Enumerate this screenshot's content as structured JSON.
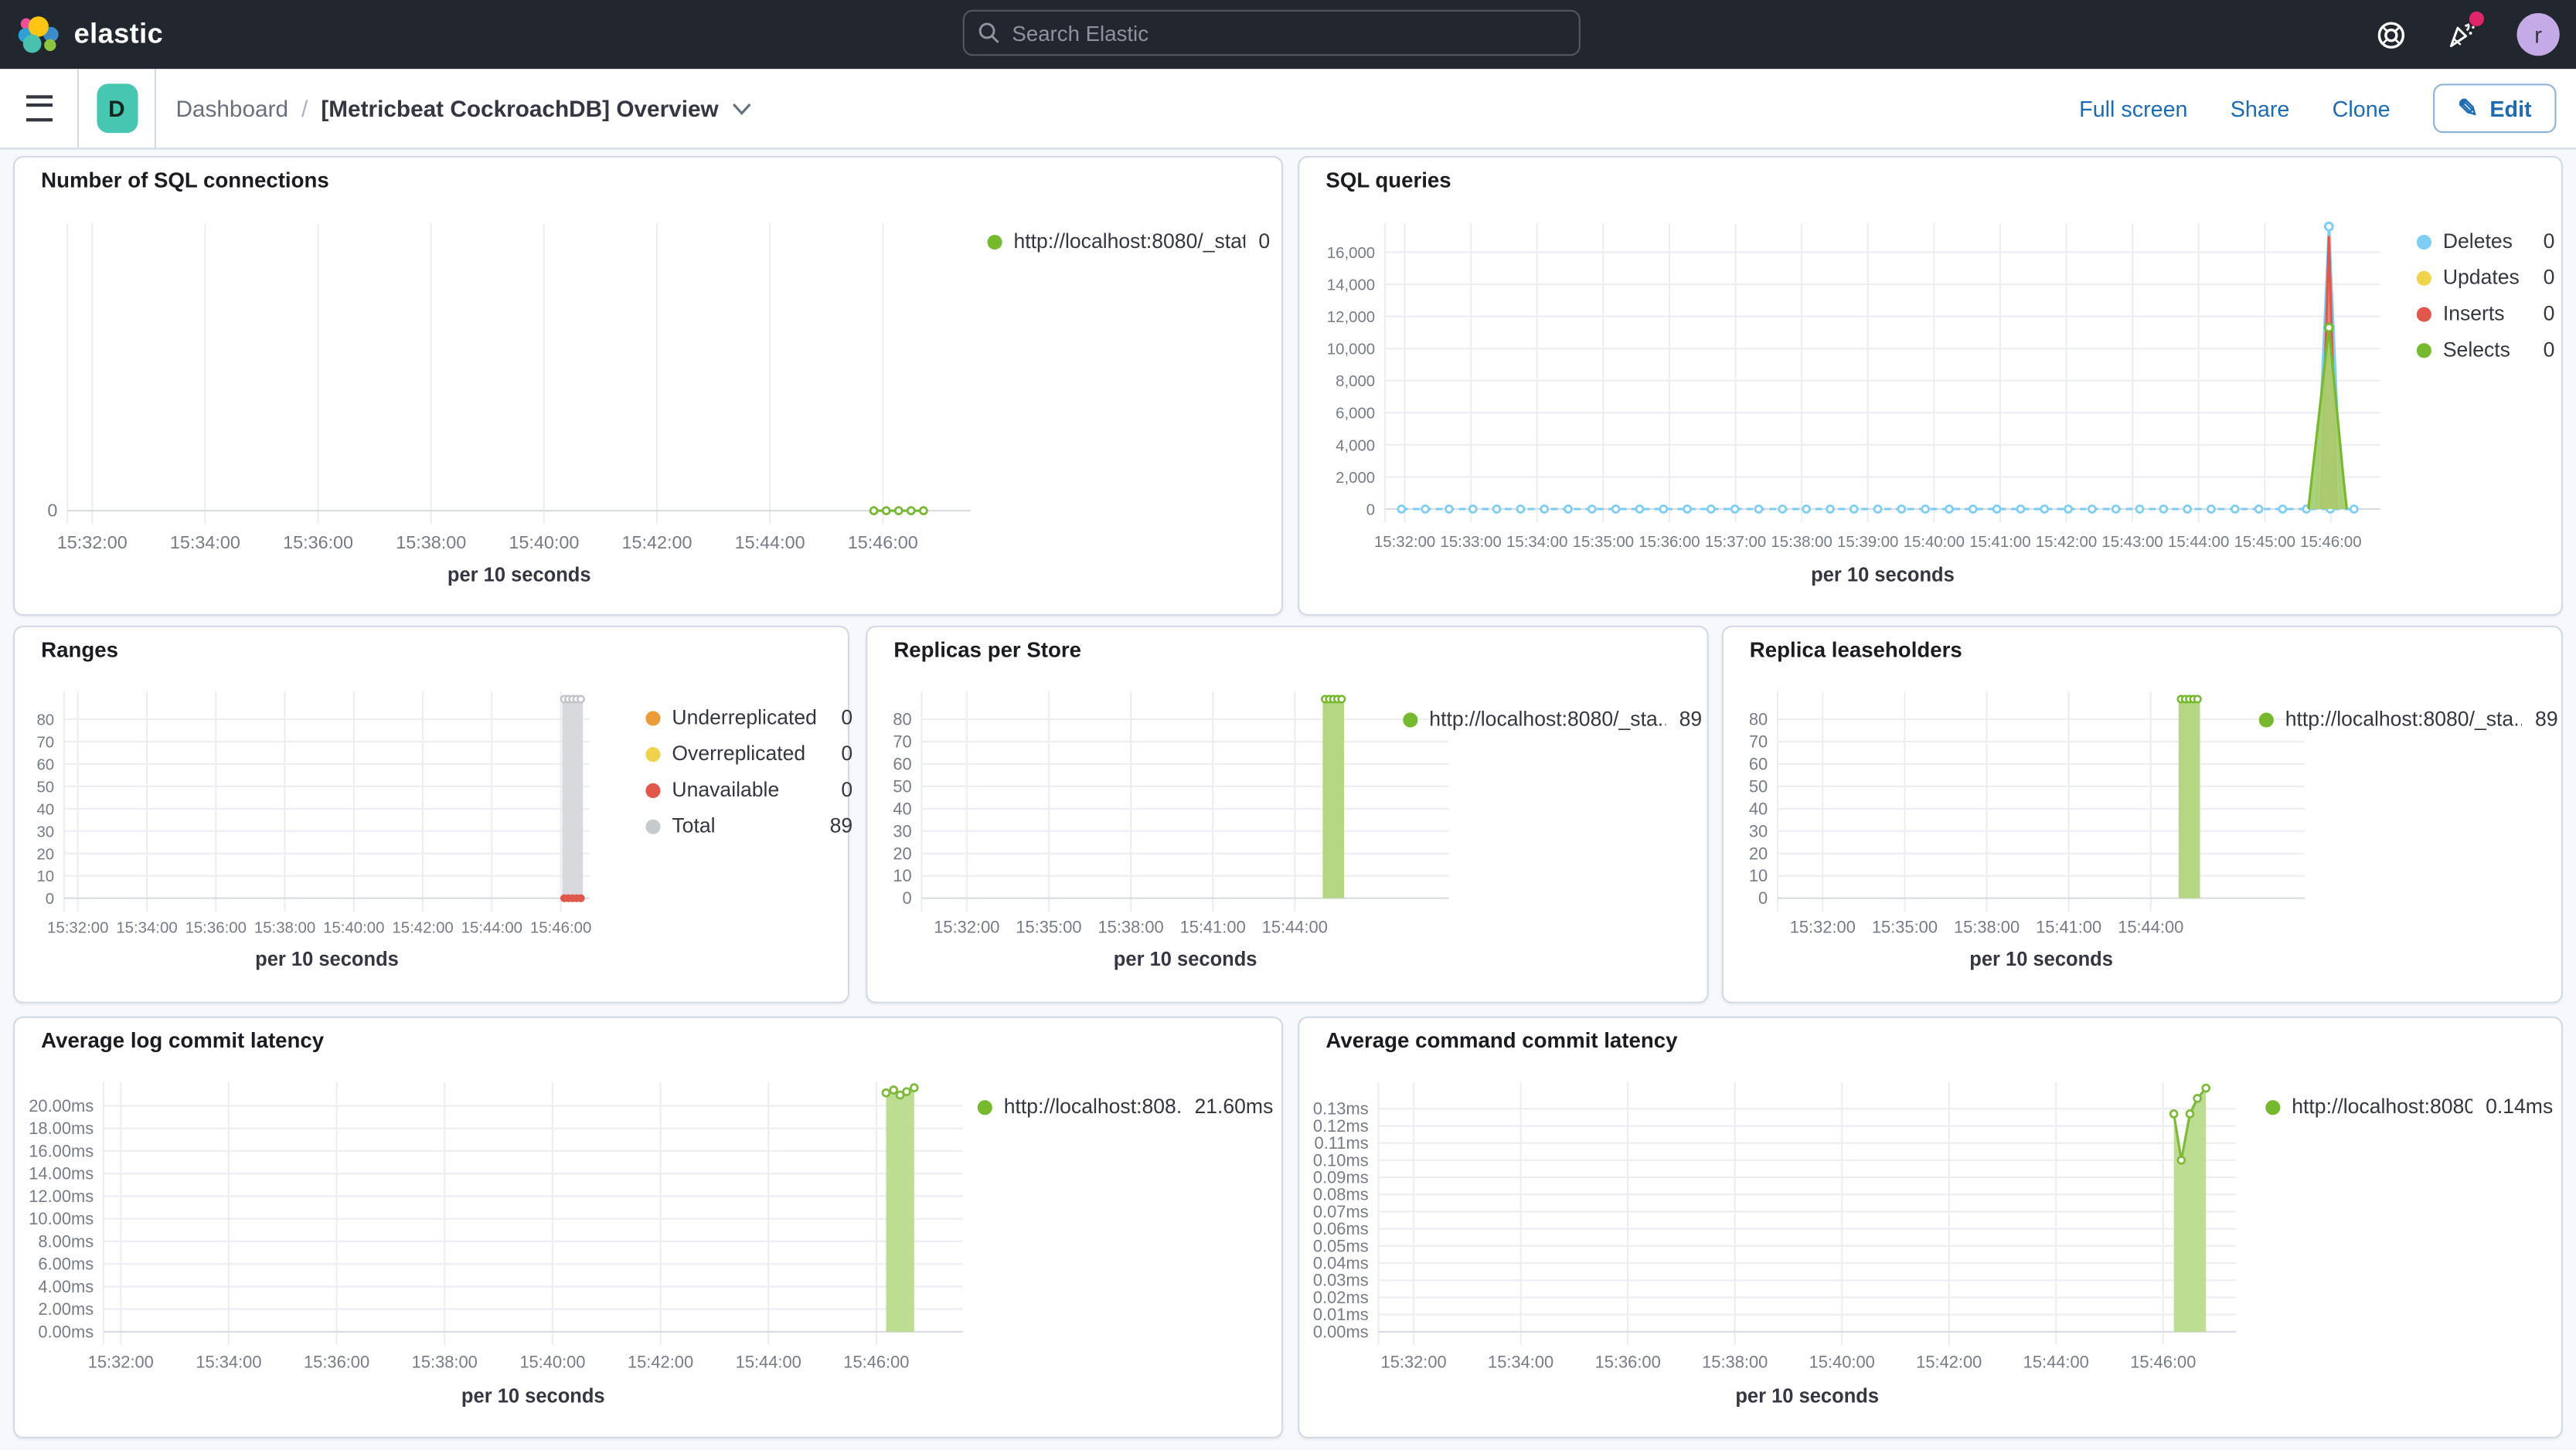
{
  "header": {
    "brand": "elastic",
    "search_placeholder": "Search Elastic",
    "avatar_initial": "r",
    "colors": {
      "header_bg": "#22262e",
      "notification_dot": "#e0256b",
      "avatar_bg": "#c5aae8",
      "space_badge": "#47c6b1",
      "link_blue": "#1d6cb2"
    }
  },
  "breadcrumbs": {
    "space_initial": "D",
    "root": "Dashboard",
    "separator": "/",
    "current": "[Metricbeat CockroachDB] Overview"
  },
  "toolbar": {
    "full_screen": "Full screen",
    "share": "Share",
    "clone": "Clone",
    "edit": "Edit"
  },
  "panels": [
    {
      "title": "Number of SQL connections",
      "legend": [
        {
          "label": "http://localhost:8080/_stat...",
          "value": "0",
          "color": "#76b82e"
        }
      ],
      "chart_data": {
        "type": "line",
        "xlabel": "per 10 seconds",
        "x_ticks": [
          "15:32:00",
          "15:34:00",
          "15:36:00",
          "15:38:00",
          "15:40:00",
          "15:42:00",
          "15:44:00",
          "15:46:00"
        ],
        "x_domain": [
          -0.22,
          7.78
        ],
        "ylim": [
          0,
          1.4
        ],
        "y_ticks": [
          {
            "v": 0,
            "label": "0"
          }
        ],
        "series": [
          {
            "name": "http://localhost:8080/_stat...",
            "type": "line",
            "color": "#76b82e",
            "marker": true,
            "points": [
              [
                6.92,
                0
              ],
              [
                7.03,
                0
              ],
              [
                7.14,
                0
              ],
              [
                7.25,
                0
              ],
              [
                7.36,
                0
              ]
            ]
          }
        ]
      }
    },
    {
      "title": "SQL queries",
      "legend": [
        {
          "label": "Deletes",
          "value": "0",
          "color": "#7ecdf2"
        },
        {
          "label": "Updates",
          "value": "0",
          "color": "#efd44c"
        },
        {
          "label": "Inserts",
          "value": "0",
          "color": "#e2574c"
        },
        {
          "label": "Selects",
          "value": "0",
          "color": "#76b82e"
        }
      ],
      "chart_data": {
        "type": "line",
        "xlabel": "per 10 seconds",
        "x_ticks": [
          "15:32:00",
          "15:33:00",
          "15:34:00",
          "15:35:00",
          "15:36:00",
          "15:37:00",
          "15:38:00",
          "15:39:00",
          "15:40:00",
          "15:41:00",
          "15:42:00",
          "15:43:00",
          "15:44:00",
          "15:45:00",
          "15:46:00"
        ],
        "x_domain": [
          -0.3,
          14.75
        ],
        "ylim": [
          0,
          17800
        ],
        "y_ticks": [
          {
            "v": 16000,
            "label": "16,000"
          },
          {
            "v": 14000,
            "label": "14,000"
          },
          {
            "v": 12000,
            "label": "12,000"
          },
          {
            "v": 10000,
            "label": "10,000"
          },
          {
            "v": 8000,
            "label": "8,000"
          },
          {
            "v": 6000,
            "label": "6,000"
          },
          {
            "v": 4000,
            "label": "4,000"
          },
          {
            "v": 2000,
            "label": "2,000"
          },
          {
            "v": 0,
            "label": "0"
          }
        ],
        "series": [
          {
            "name": "Deletes",
            "type": "line",
            "color": "#7ecdf2",
            "dash": true,
            "marker": true,
            "y_const": 0,
            "x_range": [
              -0.05,
              14.6
            ],
            "marker_step": 0.36
          },
          {
            "name": "Deletes",
            "type": "line",
            "color": "#7ecdf2",
            "marker": "peak",
            "points": [
              [
                13.78,
                0
              ],
              [
                13.97,
                17600
              ],
              [
                14.16,
                0
              ]
            ]
          },
          {
            "name": "Inserts",
            "type": "area",
            "color": "#e2574c",
            "fill": "#e2574c",
            "fill_opacity": 0.72,
            "points": [
              [
                13.85,
                0
              ],
              [
                13.97,
                17000
              ],
              [
                14.09,
                0
              ]
            ]
          },
          {
            "name": "Selects",
            "type": "area",
            "color": "#76b82e",
            "fill": "#a9cf70",
            "fill_opacity": 0.95,
            "marker": "peak",
            "points": [
              [
                13.66,
                0
              ],
              [
                13.7,
                1500
              ],
              [
                13.97,
                11300
              ],
              [
                14.2,
                1500
              ],
              [
                14.24,
                0
              ]
            ]
          }
        ]
      }
    },
    {
      "title": "Ranges",
      "legend": [
        {
          "label": "Underreplicated",
          "value": "0",
          "color": "#ec9b3a"
        },
        {
          "label": "Overreplicated",
          "value": "0",
          "color": "#f0d34c"
        },
        {
          "label": "Unavailable",
          "value": "0",
          "color": "#e2574c"
        },
        {
          "label": "Total",
          "value": "89",
          "color": "#c6c9ce"
        }
      ],
      "chart_data": {
        "type": "bar",
        "xlabel": "per 10 seconds",
        "x_ticks": [
          "15:32:00",
          "15:34:00",
          "15:36:00",
          "15:38:00",
          "15:40:00",
          "15:42:00",
          "15:44:00",
          "15:46:00"
        ],
        "x_domain": [
          -0.2,
          7.42
        ],
        "ylim": [
          0,
          92.5
        ],
        "y_ticks": [
          {
            "v": 80,
            "label": "80"
          },
          {
            "v": 70,
            "label": "70"
          },
          {
            "v": 60,
            "label": "60"
          },
          {
            "v": 50,
            "label": "50"
          },
          {
            "v": 40,
            "label": "40"
          },
          {
            "v": 30,
            "label": "30"
          },
          {
            "v": 20,
            "label": "20"
          },
          {
            "v": 10,
            "label": "10"
          },
          {
            "v": 0,
            "label": "0"
          }
        ],
        "series": [
          {
            "name": "Total",
            "type": "bar",
            "color": "#d7d9dd",
            "x": 7.17,
            "bar_width": 0.3,
            "y": 89
          },
          {
            "name": "Total",
            "type": "dots",
            "color": "#c2c5cb",
            "hollow": true,
            "r": 2,
            "points": [
              [
                7.05,
                89
              ],
              [
                7.11,
                89
              ],
              [
                7.17,
                89
              ],
              [
                7.23,
                89
              ],
              [
                7.29,
                89
              ]
            ]
          },
          {
            "name": "Unavailable",
            "type": "dots",
            "color": "#e2574c",
            "r": 2.4,
            "points": [
              [
                7.05,
                0
              ],
              [
                7.11,
                0
              ],
              [
                7.17,
                0
              ],
              [
                7.23,
                0
              ],
              [
                7.29,
                0
              ]
            ]
          }
        ]
      }
    },
    {
      "title": "Replicas per Store",
      "legend": [
        {
          "label": "http://localhost:8080/_sta...",
          "value": "89",
          "color": "#76b82e"
        }
      ],
      "chart_data": {
        "type": "bar",
        "xlabel": "per 10 seconds",
        "x_ticks": [
          "15:32:00",
          "15:35:00",
          "15:38:00",
          "15:41:00",
          "15:44:00"
        ],
        "x_domain": [
          -0.55,
          5.88
        ],
        "ylim": [
          0,
          92.5
        ],
        "y_ticks": [
          {
            "v": 80,
            "label": "80"
          },
          {
            "v": 70,
            "label": "70"
          },
          {
            "v": 60,
            "label": "60"
          },
          {
            "v": 50,
            "label": "50"
          },
          {
            "v": 40,
            "label": "40"
          },
          {
            "v": 30,
            "label": "30"
          },
          {
            "v": 20,
            "label": "20"
          },
          {
            "v": 10,
            "label": "10"
          },
          {
            "v": 0,
            "label": "0"
          }
        ],
        "series": [
          {
            "name": "http://localhost:8080/_sta...",
            "type": "bar",
            "color": "#b5d783",
            "x": 4.47,
            "bar_width": 0.26,
            "y": 89
          },
          {
            "name": "http://localhost:8080/_sta...",
            "type": "dots",
            "color": "#76b82e",
            "hollow": true,
            "r": 2,
            "points": [
              [
                4.37,
                89
              ],
              [
                4.42,
                89
              ],
              [
                4.47,
                89
              ],
              [
                4.52,
                89
              ],
              [
                4.57,
                89
              ]
            ]
          }
        ]
      }
    },
    {
      "title": "Replica leaseholders",
      "legend": [
        {
          "label": "http://localhost:8080/_sta...",
          "value": "89",
          "color": "#76b82e"
        }
      ],
      "chart_data": {
        "type": "bar",
        "xlabel": "per 10 seconds",
        "x_ticks": [
          "15:32:00",
          "15:35:00",
          "15:38:00",
          "15:41:00",
          "15:44:00"
        ],
        "x_domain": [
          -0.55,
          5.88
        ],
        "ylim": [
          0,
          92.5
        ],
        "y_ticks": [
          {
            "v": 80,
            "label": "80"
          },
          {
            "v": 70,
            "label": "70"
          },
          {
            "v": 60,
            "label": "60"
          },
          {
            "v": 50,
            "label": "50"
          },
          {
            "v": 40,
            "label": "40"
          },
          {
            "v": 30,
            "label": "30"
          },
          {
            "v": 20,
            "label": "20"
          },
          {
            "v": 10,
            "label": "10"
          },
          {
            "v": 0,
            "label": "0"
          }
        ],
        "series": [
          {
            "name": "http://localhost:8080/_sta...",
            "type": "bar",
            "color": "#b5d783",
            "x": 4.47,
            "bar_width": 0.26,
            "y": 89
          },
          {
            "name": "http://localhost:8080/_sta...",
            "type": "dots",
            "color": "#76b82e",
            "hollow": true,
            "r": 2,
            "points": [
              [
                4.37,
                89
              ],
              [
                4.42,
                89
              ],
              [
                4.47,
                89
              ],
              [
                4.52,
                89
              ],
              [
                4.57,
                89
              ]
            ]
          }
        ]
      }
    },
    {
      "title": "Average log commit latency",
      "legend": [
        {
          "label": "http://localhost:808...",
          "value": "21.60ms",
          "color": "#76b82e"
        }
      ],
      "chart_data": {
        "type": "area",
        "xlabel": "per 10 seconds",
        "x_ticks": [
          "15:32:00",
          "15:34:00",
          "15:36:00",
          "15:38:00",
          "15:40:00",
          "15:42:00",
          "15:44:00",
          "15:46:00"
        ],
        "x_domain": [
          -0.16,
          7.8
        ],
        "ylim": [
          0,
          22.1
        ],
        "y_ticks": [
          {
            "v": 20,
            "label": "20.00ms"
          },
          {
            "v": 18,
            "label": "18.00ms"
          },
          {
            "v": 16,
            "label": "16.00ms"
          },
          {
            "v": 14,
            "label": "14.00ms"
          },
          {
            "v": 12,
            "label": "12.00ms"
          },
          {
            "v": 10,
            "label": "10.00ms"
          },
          {
            "v": 8,
            "label": "8.00ms"
          },
          {
            "v": 6,
            "label": "6.00ms"
          },
          {
            "v": 4,
            "label": "4.00ms"
          },
          {
            "v": 2,
            "label": "2.00ms"
          },
          {
            "v": 0,
            "label": "0.00ms"
          }
        ],
        "series": [
          {
            "name": "http://localhost:808...",
            "type": "area",
            "color": "#7fba3c",
            "fill": "#b9db8c",
            "fill_opacity": 0.95,
            "marker": true,
            "points": [
              [
                7.09,
                21.15
              ],
              [
                7.16,
                21.4
              ],
              [
                7.22,
                20.95
              ],
              [
                7.28,
                21.25
              ],
              [
                7.35,
                21.6
              ]
            ]
          }
        ]
      }
    },
    {
      "title": "Average command commit latency",
      "legend": [
        {
          "label": "http://localhost:8080...",
          "value": "0.14ms",
          "color": "#76b82e"
        }
      ],
      "chart_data": {
        "type": "area",
        "xlabel": "per 10 seconds",
        "x_ticks": [
          "15:32:00",
          "15:34:00",
          "15:36:00",
          "15:38:00",
          "15:40:00",
          "15:42:00",
          "15:44:00",
          "15:46:00"
        ],
        "x_domain": [
          -0.33,
          7.68
        ],
        "ylim": [
          0,
          0.1455
        ],
        "y_ticks": [
          {
            "v": 0.13,
            "label": "0.13ms"
          },
          {
            "v": 0.12,
            "label": "0.12ms"
          },
          {
            "v": 0.11,
            "label": "0.11ms"
          },
          {
            "v": 0.1,
            "label": "0.10ms"
          },
          {
            "v": 0.09,
            "label": "0.09ms"
          },
          {
            "v": 0.08,
            "label": "0.08ms"
          },
          {
            "v": 0.07,
            "label": "0.07ms"
          },
          {
            "v": 0.06,
            "label": "0.06ms"
          },
          {
            "v": 0.05,
            "label": "0.05ms"
          },
          {
            "v": 0.04,
            "label": "0.04ms"
          },
          {
            "v": 0.03,
            "label": "0.03ms"
          },
          {
            "v": 0.02,
            "label": "0.02ms"
          },
          {
            "v": 0.01,
            "label": "0.01ms"
          },
          {
            "v": 0,
            "label": "0.00ms"
          }
        ],
        "series": [
          {
            "name": "http://localhost:8080...",
            "type": "area",
            "color": "#7fba3c",
            "fill": "#b9db8c",
            "fill_opacity": 0.95,
            "marker": true,
            "points": [
              [
                7.1,
                0.127
              ],
              [
                7.17,
                0.1
              ],
              [
                7.25,
                0.127
              ],
              [
                7.32,
                0.136
              ],
              [
                7.4,
                0.142
              ]
            ]
          }
        ]
      }
    }
  ]
}
